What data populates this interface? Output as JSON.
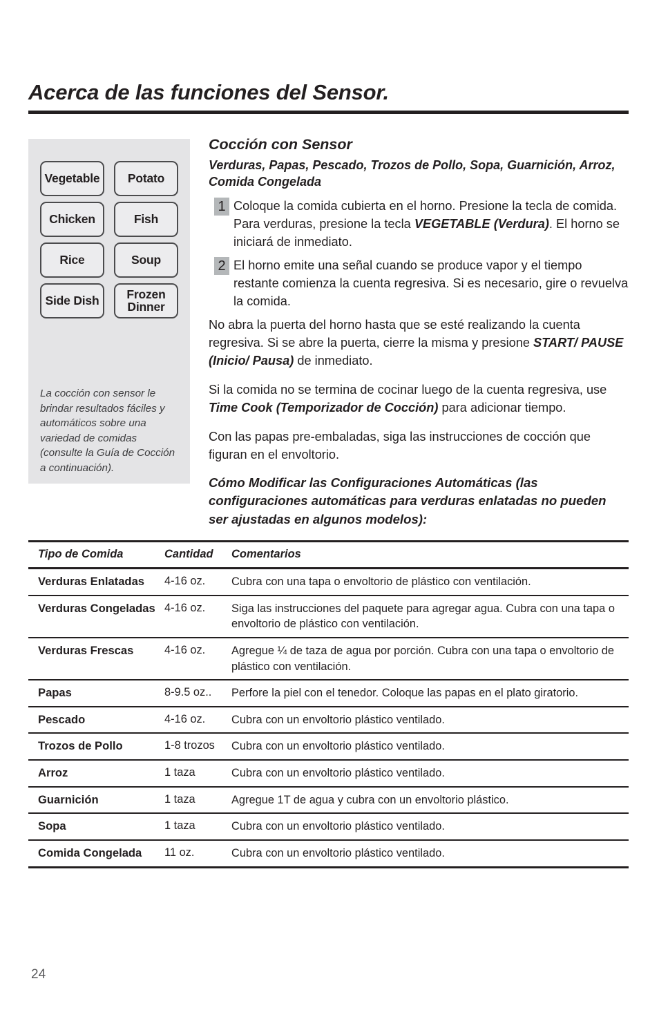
{
  "document": {
    "title": "Acerca de las funciones del Sensor.",
    "page_number": "24"
  },
  "side_panel": {
    "keys": [
      {
        "label": "Vegetable"
      },
      {
        "label": "Potato"
      },
      {
        "label": "Chicken"
      },
      {
        "label": "Fish"
      },
      {
        "label": "Rice"
      },
      {
        "label": "Soup"
      },
      {
        "label": "Side Dish"
      },
      {
        "label": "Frozen\nDinner"
      }
    ],
    "caption": "La cocción con sensor le brindar resultados fáciles y automáticos sobre una variedad de comidas (consulte la Guía de Cocción a continuación)."
  },
  "main": {
    "section_heading": "Cocción con Sensor",
    "subheading": "Verduras, Papas, Pescado, Trozos de Pollo, Sopa, Guarnición, Arroz, Comida Congelada",
    "steps": [
      {
        "number": "1",
        "text_before": "Coloque la comida cubierta en el horno. Presione la tecla de comida. Para verduras, presione la tecla ",
        "emphasis": "VEGETABLE (Verdura)",
        "text_after": ". El horno se iniciará de inmediato."
      },
      {
        "number": "2",
        "text_before": "El horno emite una señal cuando se produce vapor y el tiempo restante comienza la cuenta regresiva. Si es necesario, gire o revuelva la comida.",
        "emphasis": "",
        "text_after": ""
      }
    ],
    "paragraphs": [
      {
        "text_before": "No abra la puerta del horno hasta que se esté realizando la cuenta regresiva. Si se abre la puerta, cierre la misma y presione ",
        "emphasis": "START/ PAUSE (Inicio/ Pausa)",
        "text_after": " de inmediato."
      },
      {
        "text_before": "Si la comida no se termina de cocinar luego de la cuenta regresiva, use ",
        "emphasis": "Time Cook (Temporizador de Cocción)",
        "text_after": " para adicionar tiempo."
      },
      {
        "text_before": "Con las papas pre-embaladas, siga las instrucciones de cocción que figuran en el envoltorio.",
        "emphasis": "",
        "text_after": ""
      }
    ],
    "modify_heading": "Cómo Modificar las Configuraciones Automáticas (las configuraciones automáticas para verduras enlatadas no pueden ser ajustadas en algunos modelos):"
  },
  "table": {
    "headers": [
      "Tipo de Comida",
      "Cantidad",
      "Comentarios"
    ],
    "rows": [
      {
        "food": "Verduras Enlatadas",
        "qty": "4-16 oz.",
        "comment": "Cubra con una tapa o envoltorio de plástico con ventilación."
      },
      {
        "food": "Verduras Congeladas",
        "qty": "4-16 oz.",
        "comment": "Siga las instrucciones del paquete para agregar agua. Cubra con una tapa o envoltorio de plástico con ventilación."
      },
      {
        "food": "Verduras Frescas",
        "qty": "4-16 oz.",
        "comment": "Agregue ¼ de taza de agua por porción. Cubra con una tapa o envoltorio de plástico con ventilación."
      },
      {
        "food": "Papas",
        "qty": "8-9.5 oz..",
        "comment": "Perfore la piel con el tenedor. Coloque las papas en el plato giratorio."
      },
      {
        "food": "Pescado",
        "qty": "4-16 oz.",
        "comment": "Cubra con un envoltorio plástico ventilado."
      },
      {
        "food": "Trozos de Pollo",
        "qty": "1-8 trozos",
        "comment": "Cubra con un envoltorio plástico ventilado."
      },
      {
        "food": "Arroz",
        "qty": "1 taza",
        "comment": "Cubra con un envoltorio plástico ventilado."
      },
      {
        "food": "Guarnición",
        "qty": "1 taza",
        "comment": "Agregue 1T de agua y cubra con un envoltorio plástico."
      },
      {
        "food": "Sopa",
        "qty": "1 taza",
        "comment": "Cubra con un envoltorio plástico ventilado."
      },
      {
        "food": "Comida Congelada",
        "qty": "11 oz.",
        "comment": "Cubra con un envoltorio plástico ventilado."
      }
    ]
  },
  "colors": {
    "ink": "#231f20",
    "panel_bg": "#e4e4e6",
    "key_bg": "#ececee",
    "key_border": "#4b4b4d",
    "step_badge": "#b4b7b9"
  }
}
